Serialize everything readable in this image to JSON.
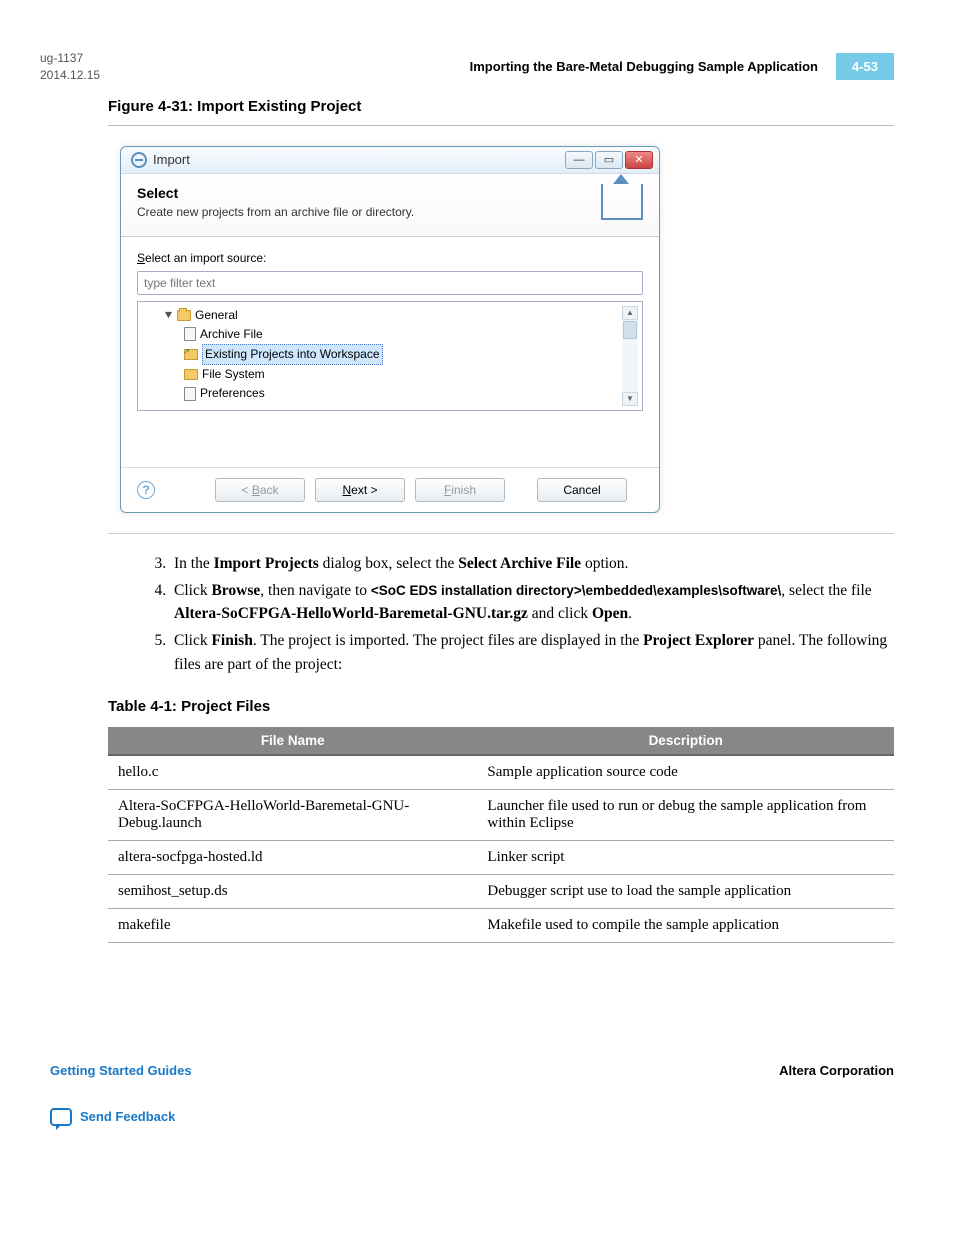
{
  "header": {
    "doc_id": "ug-1137",
    "date": "2014.12.15",
    "section_title": "Importing the Bare-Metal Debugging Sample Application",
    "page_num": "4-53"
  },
  "figure_caption": "Figure 4-31: Import Existing Project",
  "dialog": {
    "title": "Import",
    "heading": "Select",
    "subheading": "Create new projects from an archive file or directory.",
    "source_label_pre": "S",
    "source_label_post": "elect an import source:",
    "filter_placeholder": "type filter text",
    "tree": {
      "root": "General",
      "items": [
        "Archive File",
        "Existing Projects into Workspace",
        "File System",
        "Preferences"
      ],
      "selected_index": 1
    },
    "buttons": {
      "back": "< Back",
      "next": "Next >",
      "finish": "Finish",
      "cancel": "Cancel"
    }
  },
  "steps": [
    {
      "num": "3.",
      "parts": [
        "In the ",
        "Import Projects",
        " dialog box, select the ",
        "Select Archive File",
        " option."
      ]
    },
    {
      "num": "4.",
      "parts": [
        "Click ",
        "Browse",
        ", then navigate to ",
        "<SoC EDS installation directory>\\embedded\\examples\\software\\",
        ", select the file ",
        "Altera-SoCFPGA-HelloWorld-Baremetal-GNU.tar.gz",
        " and click ",
        "Open",
        "."
      ]
    },
    {
      "num": "5.",
      "parts": [
        "Click ",
        "Finish",
        ". The project is imported. The project files are displayed in the ",
        "Project Explorer",
        " panel. The following files are part of the project:"
      ]
    }
  ],
  "table": {
    "caption": "Table 4-1: Project Files",
    "headers": [
      "File Name",
      "Description"
    ],
    "rows": [
      [
        "hello.c",
        "Sample application source code"
      ],
      [
        "Altera-SoCFPGA-HelloWorld-Baremetal-GNU-Debug.launch",
        "Launcher file used to run or debug the sample application from within Eclipse"
      ],
      [
        "altera-socfpga-hosted.ld",
        "Linker script"
      ],
      [
        "semihost_setup.ds",
        "Debugger script use to load the sample application"
      ],
      [
        "makefile",
        "Makefile used to compile the sample application"
      ]
    ]
  },
  "footer": {
    "left": "Getting Started Guides",
    "right": "Altera Corporation",
    "feedback": "Send Feedback"
  }
}
